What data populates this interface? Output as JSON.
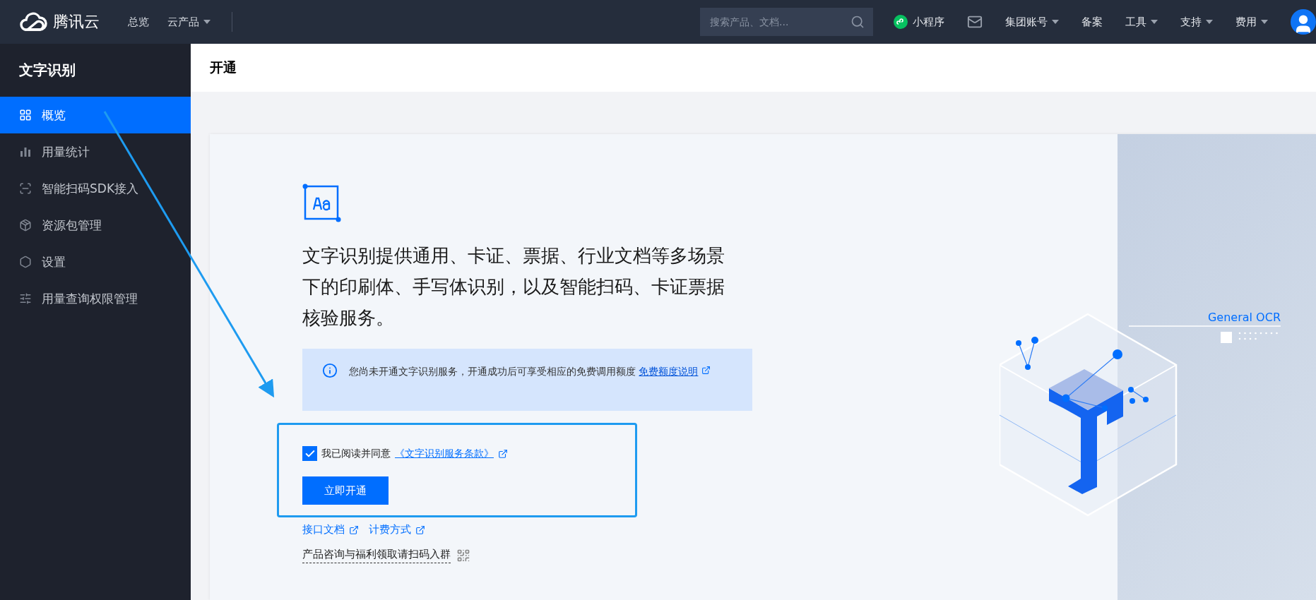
{
  "top_nav": {
    "logo": "腾讯云",
    "links": [
      {
        "label": "总览",
        "dropdown": false
      },
      {
        "label": "云产品",
        "dropdown": true
      }
    ],
    "search": {
      "placeholder": "搜索产品、文档..."
    },
    "right_items": [
      {
        "kind": "miniapp",
        "label": "小程序",
        "dropdown": false
      },
      {
        "kind": "mail"
      },
      {
        "kind": "menu",
        "label": "集团账号",
        "dropdown": true
      },
      {
        "kind": "menu",
        "label": "备案",
        "dropdown": false
      },
      {
        "kind": "menu",
        "label": "工具",
        "dropdown": true
      },
      {
        "kind": "menu",
        "label": "支持",
        "dropdown": true
      },
      {
        "kind": "menu",
        "label": "费用",
        "dropdown": true
      },
      {
        "kind": "avatar"
      }
    ]
  },
  "sidebar": {
    "title": "文字识别",
    "items": [
      {
        "kind": "grid",
        "label": "概览",
        "selected": true
      },
      {
        "kind": "bars",
        "label": "用量统计",
        "selected": false
      },
      {
        "kind": "scan",
        "label": "智能扫码SDK接入",
        "selected": false
      },
      {
        "kind": "package",
        "label": "资源包管理",
        "selected": false
      },
      {
        "kind": "hexagon",
        "label": "设置",
        "selected": false
      },
      {
        "kind": "sliders",
        "label": "用量查询权限管理",
        "selected": false
      }
    ]
  },
  "page_header": {
    "title": "开通"
  },
  "intro": "文字识别提供通用、卡证、票据、行业文档等多场景下的印刷体、手写体识别，以及智能扫码、卡证票据核验服务。",
  "notice": {
    "text": "您尚未开通文字识别服务，开通成功后可享受相应的免费调用额度",
    "link": "免费额度说明"
  },
  "agreement": {
    "checked": true,
    "prefix": "我已阅读并同意",
    "link": "《文字识别服务条款》"
  },
  "activate_button": "立即开通",
  "links": [
    "接口文档",
    "计费方式"
  ],
  "consult": "产品咨询与福利领取请扫码入群",
  "illustration": {
    "label": "General OCR"
  }
}
